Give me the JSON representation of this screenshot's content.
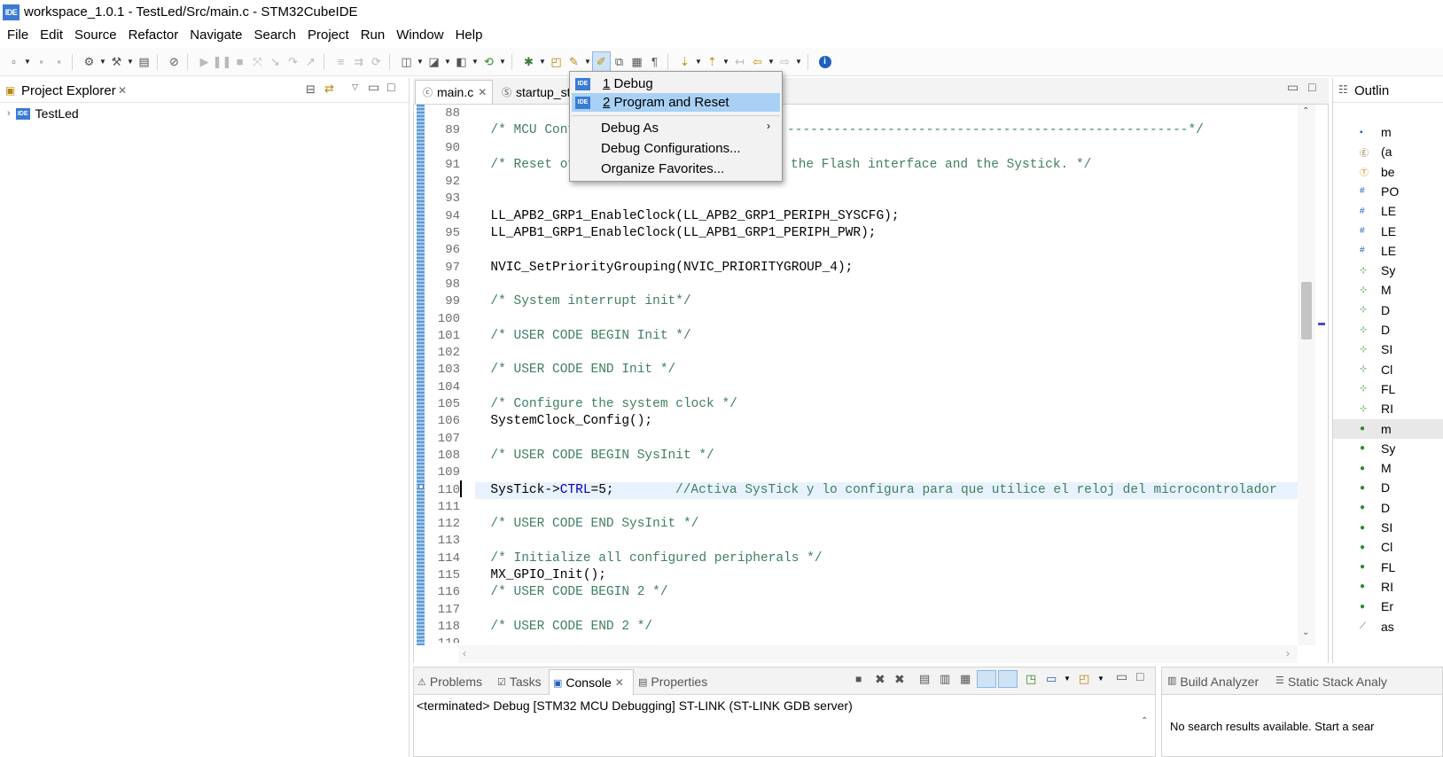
{
  "window": {
    "title": "workspace_1.0.1 - TestLed/Src/main.c - STM32CubeIDE",
    "app_icon": "IDE"
  },
  "menubar": [
    "File",
    "Edit",
    "Source",
    "Refactor",
    "Navigate",
    "Search",
    "Project",
    "Run",
    "Window",
    "Help"
  ],
  "project_explorer": {
    "title": "Project Explorer",
    "items": [
      {
        "label": "TestLed",
        "icon": "IDE"
      }
    ]
  },
  "editor": {
    "tabs": [
      {
        "label": "main.c",
        "active": true
      },
      {
        "label": "startup_st",
        "active": false
      }
    ],
    "line_numbers": [
      "88",
      "89",
      "90",
      "91",
      "92",
      "93",
      "94",
      "95",
      "96",
      "97",
      "98",
      "99",
      "100",
      "101",
      "102",
      "103",
      "104",
      "105",
      "106",
      "107",
      "108",
      "109",
      "110",
      "111",
      "112",
      "113",
      "114",
      "115",
      "116",
      "117",
      "118",
      "119"
    ],
    "lines": [
      "",
      "  /* MCU Confi",
      "",
      "  /* Reset of ",
      "",
      "",
      "  LL_APB2_GRP1_EnableClock(LL_APB2_GRP1_PERIPH_SYSCFG);",
      "  LL_APB1_GRP1_EnableClock(LL_APB1_GRP1_PERIPH_PWR);",
      "",
      "  NVIC_SetPriorityGrouping(NVIC_PRIORITYGROUP_4);",
      "",
      "  /* System interrupt init*/",
      "",
      "  /* USER CODE BEGIN Init */",
      "",
      "  /* USER CODE END Init */",
      "",
      "  /* Configure the system clock */",
      "  SystemClock_Config();",
      "",
      "  /* USER CODE BEGIN SysInit */",
      "",
      "  SysTick->CTRL=5;",
      "",
      "  /* USER CODE END SysInit */",
      "",
      "  /* Initialize all configured peripherals */",
      "  MX_GPIO_Init();",
      "  /* USER CODE BEGIN 2 */",
      "",
      "  /* USER CODE END 2 */",
      ""
    ],
    "line89_tail": "----------------------------------------------------*/",
    "line91_tail": "the Flash interface and the Systick. */",
    "line110_comment": "//Activa SysTick y lo configura para que utilice el reloj del microcontrolador"
  },
  "dropdown": {
    "items": [
      {
        "number": "1",
        "label": " Debug",
        "icon": "IDE"
      },
      {
        "number": "2",
        "label": " Program and Reset",
        "icon": "IDE",
        "selected": true
      },
      {
        "label": "Debug As",
        "submenu": true
      },
      {
        "label": "Debug Configurations..."
      },
      {
        "label": "Organize Favorites..."
      }
    ]
  },
  "outline": {
    "title": "Outlin",
    "rows": [
      "m",
      "(a",
      "be",
      "PO",
      "LE",
      "LE",
      "LE",
      "Sy",
      "M",
      "D",
      "D",
      "SI",
      "Cl",
      "FL",
      "RI",
      "m",
      "Sy",
      "M",
      "D",
      "D",
      "SI",
      "Cl",
      "FL",
      "RI",
      "Er",
      "as"
    ]
  },
  "bottom": {
    "tabs": [
      "Problems",
      "Tasks",
      "Console",
      "Properties"
    ],
    "active_tab": "Console",
    "console_text": "<terminated> Debug [STM32 MCU Debugging] ST-LINK (ST-LINK GDB server)",
    "right_tabs": [
      "Build Analyzer",
      "Static Stack Analy"
    ],
    "right_text": "No search results available. Start a sear"
  },
  "colors": {
    "accent": "#3a7bd5",
    "selection": "#a8d1f5",
    "comment": "#3f7f5f",
    "keyword": "#0000c0"
  }
}
